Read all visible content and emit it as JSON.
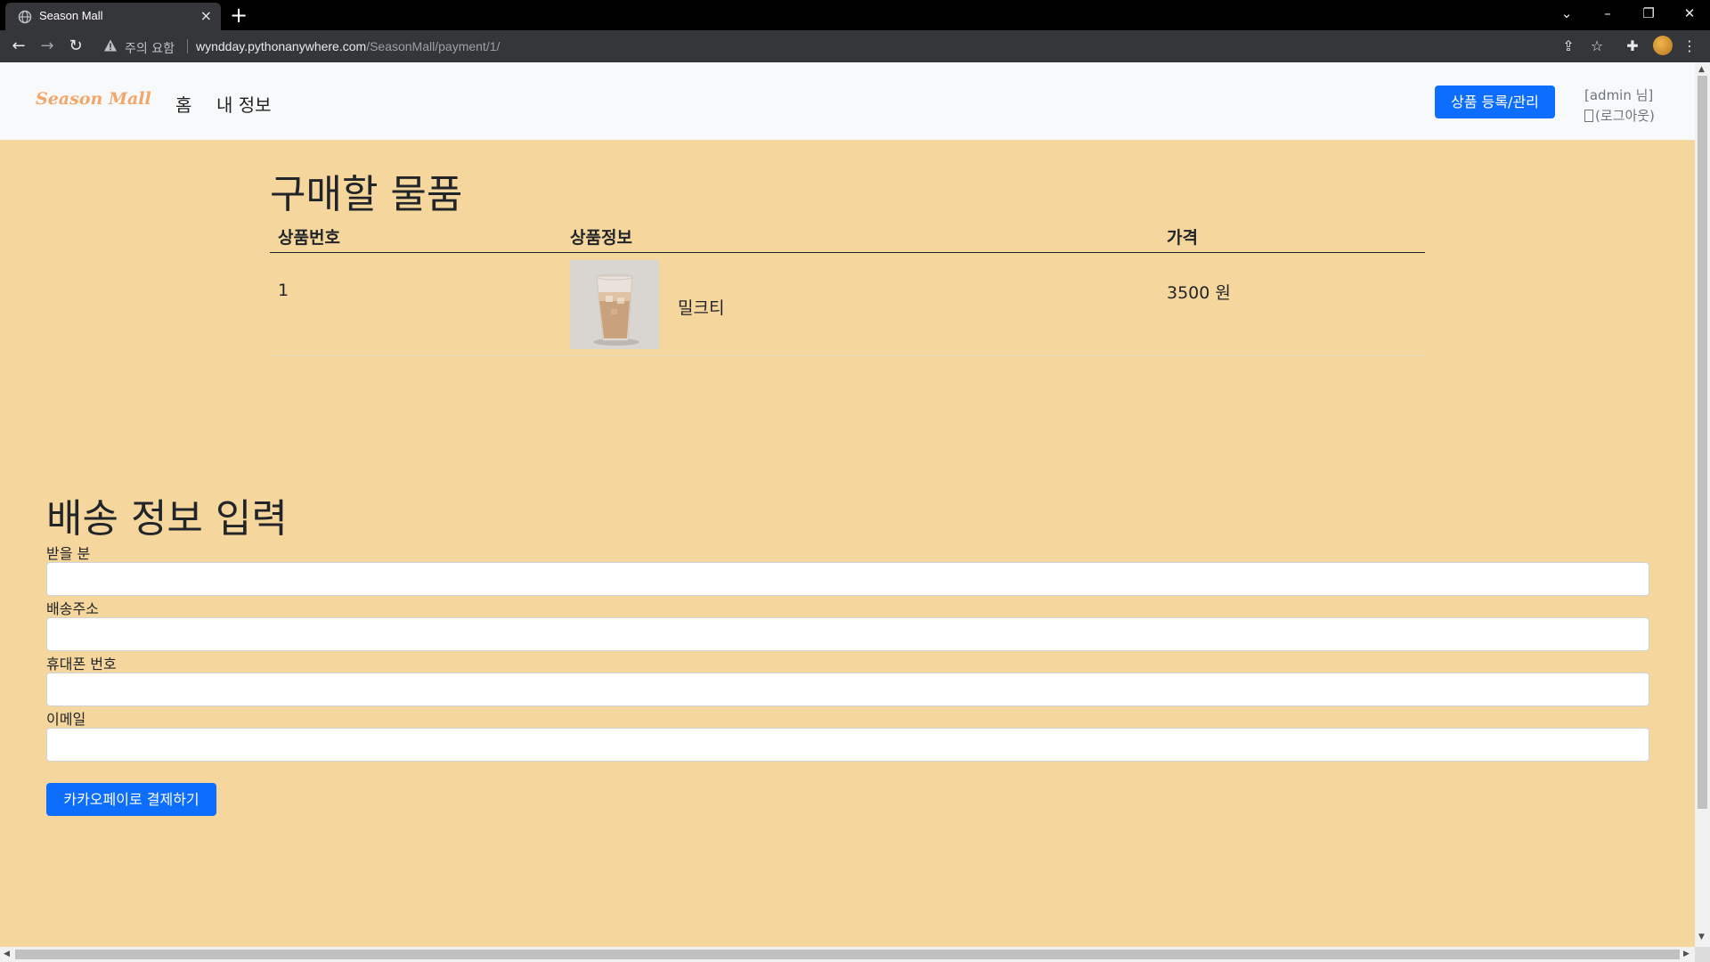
{
  "browser": {
    "tab_title": "Season Mall",
    "tab_close": "×",
    "new_tab": "+",
    "security_warning": "주의 요함",
    "url_host": "wyndday.pythonanywhere.com",
    "url_path": "/SeasonMall/payment/1/"
  },
  "navbar": {
    "brand": "Season Mall",
    "links": [
      "홈",
      "내 정보"
    ],
    "manage_button": "상품 등록/관리",
    "user_greeting": "[admin 님]",
    "logout": "(로그아웃)"
  },
  "order": {
    "title": "구매할 물품",
    "columns": [
      "상품번호",
      "상품정보",
      "가격"
    ],
    "rows": [
      {
        "number": "1",
        "name": "밀크티",
        "price": "3500 원",
        "thumbnail": "iced-milk-tea"
      }
    ]
  },
  "shipping": {
    "title": "배송 정보 입력",
    "fields": [
      {
        "label": "받을 분",
        "value": ""
      },
      {
        "label": "배송주소",
        "value": ""
      },
      {
        "label": "휴대폰 번호",
        "value": ""
      },
      {
        "label": "이메일",
        "value": ""
      }
    ],
    "submit": "카카오페이로 결제하기"
  },
  "colors": {
    "page_background": "#f5d69c",
    "navbar_background": "#f8f9fa",
    "primary": "#0d6efd",
    "brand": "#f2a76a"
  }
}
